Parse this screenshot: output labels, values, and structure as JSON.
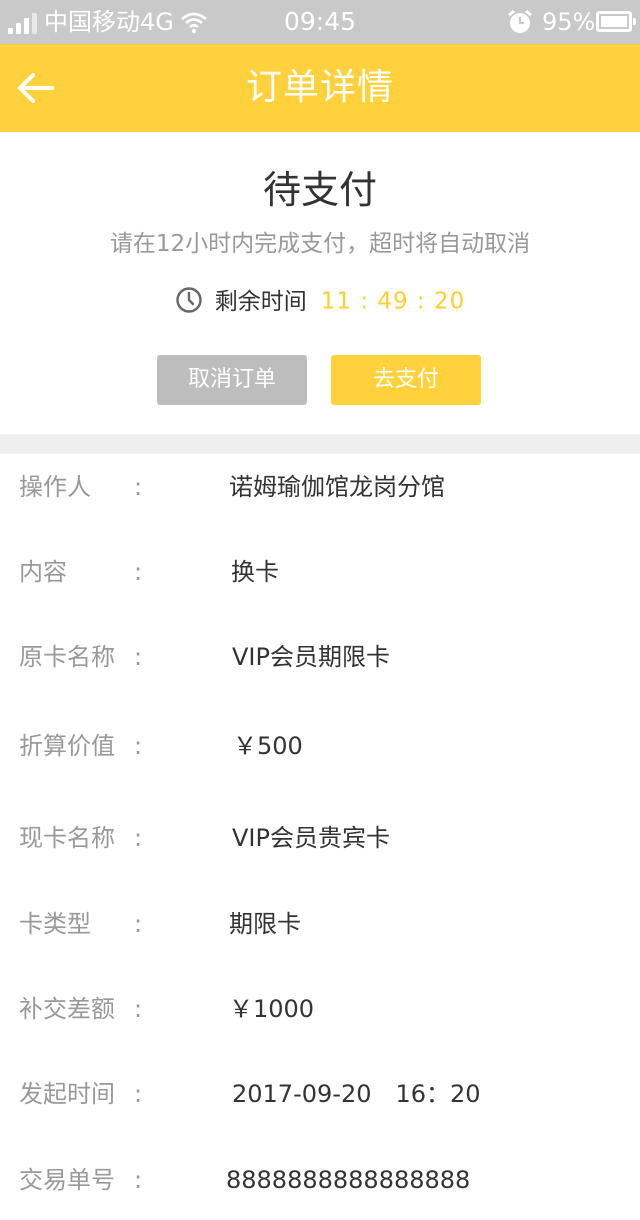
{
  "status_bar": {
    "carrier": "中国移动4G",
    "time": "09:45",
    "battery": "95%"
  },
  "header": {
    "title": "订单详情",
    "back_icon": "arrow-left-icon",
    "background_color": "#ffd23d"
  },
  "order_status": {
    "title": "待支付",
    "hint": "请在12小时内完成支付，超时将自动取消",
    "countdown_label": "剩余时间",
    "countdown_value": "11 : 49 : 20",
    "countdown_color": "#ffcd2e"
  },
  "actions": {
    "cancel_label": "取消订单",
    "pay_label": "去支付"
  },
  "details": {
    "colon": ":",
    "rows": [
      {
        "label": "操作人",
        "value": "诺姆瑜伽馆龙岗分馆"
      },
      {
        "label": "内容",
        "value": "换卡"
      },
      {
        "label": "原卡名称",
        "value": "VIP会员期限卡"
      },
      {
        "label": "折算价值",
        "value": "￥500"
      },
      {
        "label": "现卡名称",
        "value": "VIP会员贵宾卡"
      },
      {
        "label": "卡类型",
        "value": "期限卡"
      },
      {
        "label": "补交差额",
        "value": "￥1000"
      },
      {
        "label": "发起时间",
        "value": "2017-09-20　16：20"
      },
      {
        "label": "交易单号",
        "value": "8888888888888888"
      }
    ]
  }
}
